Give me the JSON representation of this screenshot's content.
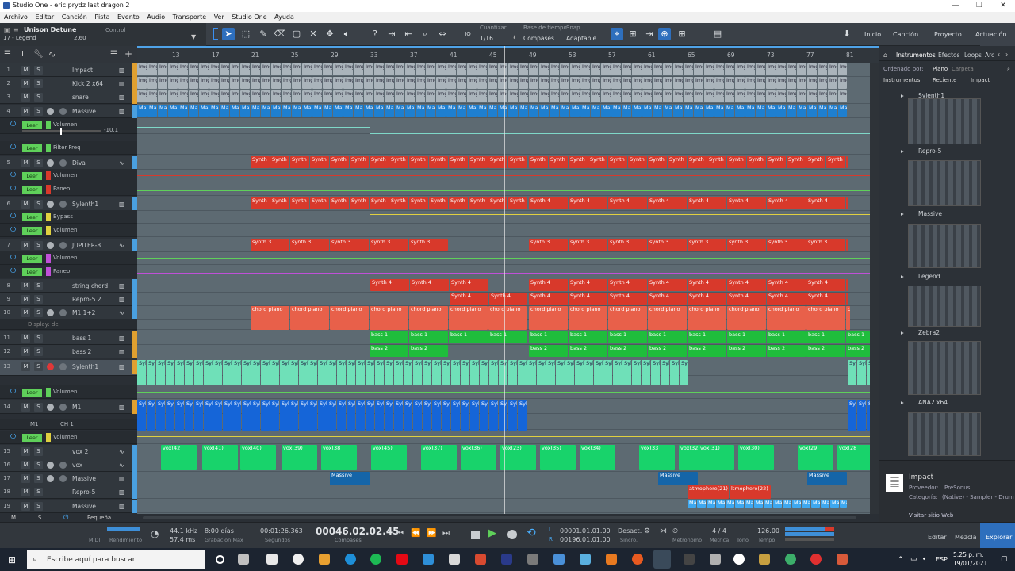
{
  "window": {
    "title": "Studio One - eric prydz last dragon 2"
  },
  "menu": [
    "Archivo",
    "Editar",
    "Canción",
    "Pista",
    "Evento",
    "Audio",
    "Transporte",
    "Ver",
    "Studio One",
    "Ayuda"
  ],
  "instrument": {
    "name": "Unison Detune",
    "preset": "17 - Legend",
    "value": "2.60",
    "control": "Control"
  },
  "quantize": {
    "label": "Cuantizar",
    "value": "1/16",
    "timebase_label": "Base de tiempo",
    "timebase_value": "Compases",
    "snap_label": "Snap",
    "snap_value": "Adaptable"
  },
  "nav": {
    "inicio": "Inicio",
    "cancion": "Canción",
    "proyecto": "Proyecto",
    "actuacion": "Actuación"
  },
  "ruler": [
    "13",
    "17",
    "21",
    "25",
    "29",
    "33",
    "37",
    "41",
    "45",
    "49",
    "53",
    "57",
    "61",
    "65",
    "69",
    "73",
    "77",
    "81"
  ],
  "tracks": [
    {
      "num": "1",
      "name": "Impact",
      "color": "#e0a030"
    },
    {
      "num": "2",
      "name": "Kick 2 x64",
      "color": "#e0a030"
    },
    {
      "num": "3",
      "name": "snare",
      "color": "#e0a030"
    },
    {
      "num": "4",
      "name": "Massive",
      "color": "#4aa0e0"
    },
    {
      "num": "5",
      "name": "Diva",
      "color": "#4aa0e0"
    },
    {
      "num": "6",
      "name": "Sylenth1",
      "color": "#4aa0e0"
    },
    {
      "num": "7",
      "name": "JUPITER-8",
      "color": "#4aa0e0"
    },
    {
      "num": "8",
      "name": "string chord",
      "color": "#4aa0e0"
    },
    {
      "num": "9",
      "name": "Repro-5 2",
      "color": "#4aa0e0"
    },
    {
      "num": "10",
      "name": "M1 1+2",
      "color": "#4aa0e0"
    },
    {
      "num": "11",
      "name": "bass 1",
      "color": "#e0a030"
    },
    {
      "num": "12",
      "name": "bass 2",
      "color": "#e0a030"
    },
    {
      "num": "13",
      "name": "Sylenth1",
      "color": "#e0a030"
    },
    {
      "num": "14",
      "name": "M1",
      "color": "#e0a030"
    },
    {
      "num": "15",
      "name": "vox 2",
      "color": "#4aa0e0"
    },
    {
      "num": "16",
      "name": "vox",
      "color": "#4aa0e0"
    },
    {
      "num": "17",
      "name": "Massive",
      "color": "#4aa0e0"
    },
    {
      "num": "18",
      "name": "Repro-5",
      "color": "#4aa0e0"
    },
    {
      "num": "19",
      "name": "Massive",
      "color": "#4aa0e0"
    }
  ],
  "automation": {
    "leer": "Leer",
    "volumen": "Volumen",
    "filter": "Filter Freq",
    "paneo": "Paneo",
    "bypass": "Bypass",
    "vol_value": "-10.1",
    "display": "Display: de",
    "m1": "M1",
    "ch": "CH 1"
  },
  "clips": {
    "img": "Img",
    "ma": "Ma",
    "synth": "Synth",
    "synth3": "synth 3",
    "synth4": "Synth 4",
    "chord": "chord piano",
    "bass1": "bass 1",
    "bass2": "bass 2",
    "syl": "Syl",
    "vox42": "vox(42",
    "vox41": "vox(41)",
    "vox40": "vox(40)",
    "vox39": "vox(39)",
    "vox38": "vox(38",
    "vox45": "vox(45)",
    "vox37": "vox(37)",
    "vox36": "vox(36)",
    "vox23": "vox(23)",
    "vox35": "vox(35)",
    "vox34": "vox(34)",
    "vox33": "vox(33",
    "vox32": "vox(32",
    "vox31": "vox(31)",
    "vox30": "vox(30)",
    "vox29": "vox(29",
    "vox28": "vox(28",
    "vox44": "vox(44)",
    "massive": "Massive",
    "atm1": "atmophere(21)",
    "atm2": "ltmophere(22)"
  },
  "bottomleft": {
    "m": "M",
    "s": "S",
    "size": "Pequeña"
  },
  "browser": {
    "tabs": [
      "Instrumentos",
      "Efectos",
      "Loops",
      "Arc"
    ],
    "sort_label": "Ordenado por:",
    "sort_value": "Plano",
    "sort_alt": "Carpeta",
    "crumbs": [
      "Instrumentos",
      "Reciente",
      "Impact"
    ],
    "items": [
      "Sylenth1",
      "Repro-5",
      "Massive",
      "Legend",
      "Zebra2",
      "ANA2 x64"
    ],
    "info_name": "Impact",
    "info_provider_label": "Proveedor:",
    "info_provider": "PreSonus",
    "info_cat_label": "Categoría:",
    "info_cat": "(Native) - Sampler - Drum",
    "visit": "Visitar sitio Web"
  },
  "transport": {
    "midi": "MIDI",
    "rend": "Rendimiento",
    "khz": "44.1 kHz",
    "ms": "57.4 ms",
    "dias": "8:00 días",
    "grab": "Grabación Max",
    "secs": "00:01:26.363",
    "secs_label": "Segundos",
    "bars": "00046.02.02.45",
    "bars_label": "Compases",
    "l": "00001.01.01.00",
    "r": "00196.01.01.00",
    "desact": "Desact.",
    "sincro": "Sincro.",
    "metronomo": "Metrónomo",
    "metric": "4 / 4",
    "metric_label": "Métrica",
    "tono": "Tono",
    "tempo": "126.00",
    "tempo_label": "Tempo",
    "editar": "Editar",
    "mezcla": "Mezcla",
    "explorar": "Explorar"
  },
  "taskbar": {
    "search": "Escribe aquí para buscar",
    "lang": "ESP",
    "time": "5:25 p. m.",
    "date": "19/01/2021"
  },
  "colors": {
    "accent": "#2e6fbd",
    "red_clip": "#d8392b",
    "green_clip": "#1fbd3c",
    "teal_clip": "#6fe0b8",
    "blue_clip": "#1565d8"
  }
}
